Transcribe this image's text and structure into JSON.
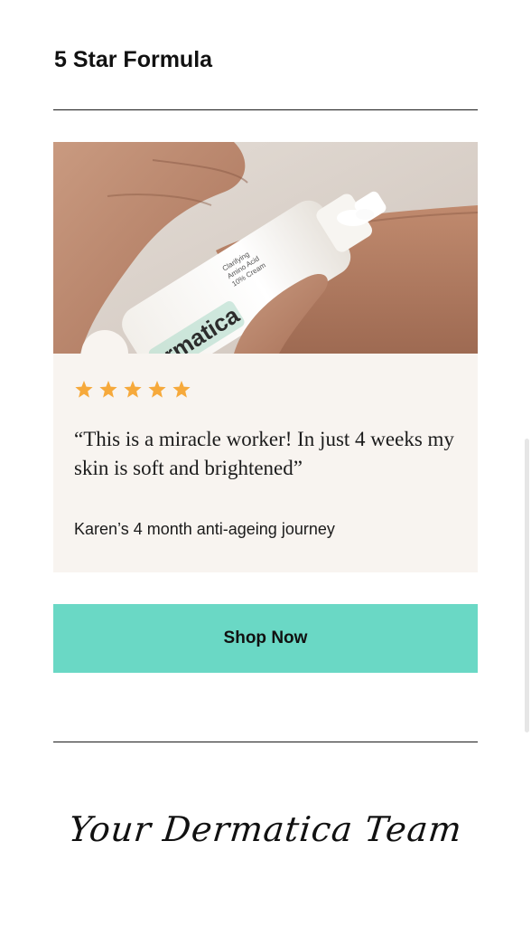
{
  "section": {
    "title": "5 Star Formula"
  },
  "review": {
    "image_label": "Product applied to hand",
    "bottle_brand": "rmatica",
    "bottle_label_lines": [
      "Clarifying",
      "Amino Acid",
      "10% Cream"
    ],
    "rating": 5,
    "rating_max": 5,
    "star_color": "#f6a93b",
    "quote": "“This is a miracle worker! In just 4 weeks my skin is soft and brightened”",
    "author_journey": "Karen’s 4 month anti-ageing journey"
  },
  "cta": {
    "label": "Shop Now",
    "color": "#6ad8c5"
  },
  "signature": {
    "text": "Your Dermatica Team"
  }
}
